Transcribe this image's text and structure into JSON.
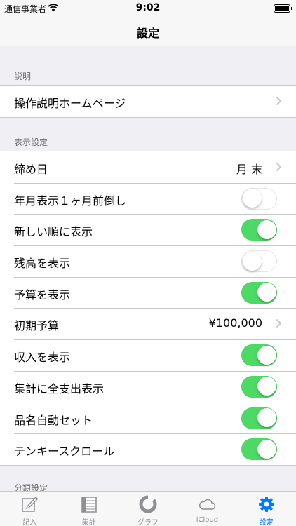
{
  "status_bar": {
    "carrier": "通信事業者",
    "time": "9:02"
  },
  "nav": {
    "title": "設定"
  },
  "sections": [
    {
      "header": "説明",
      "rows": [
        {
          "label": "操作説明ホームページ",
          "type": "link"
        }
      ]
    },
    {
      "header": "表示設定",
      "rows": [
        {
          "label": "締め日",
          "type": "value",
          "value": "月 末"
        },
        {
          "label": "年月表示１ヶ月前倒し",
          "type": "toggle",
          "on": false
        },
        {
          "label": "新しい順に表示",
          "type": "toggle",
          "on": true
        },
        {
          "label": "残高を表示",
          "type": "toggle",
          "on": false
        },
        {
          "label": "予算を表示",
          "type": "toggle",
          "on": true
        },
        {
          "label": "初期予算",
          "type": "value",
          "value": "¥100,000"
        },
        {
          "label": "収入を表示",
          "type": "toggle",
          "on": true
        },
        {
          "label": "集計に全支出表示",
          "type": "toggle",
          "on": true
        },
        {
          "label": "品名自動セット",
          "type": "toggle",
          "on": true
        },
        {
          "label": "テンキースクロール",
          "type": "toggle",
          "on": true
        }
      ]
    },
    {
      "header": "分類設定"
    }
  ],
  "tabs": [
    {
      "label": "記入",
      "icon": "pencil-note-icon",
      "active": false
    },
    {
      "label": "集計",
      "icon": "table-icon",
      "active": false
    },
    {
      "label": "グラフ",
      "icon": "pie-chart-icon",
      "active": false
    },
    {
      "label": "iCloud",
      "icon": "cloud-icon",
      "active": false
    },
    {
      "label": "設定",
      "icon": "gear-icon",
      "active": true
    }
  ],
  "colors": {
    "accent": "#007aff",
    "toggle_on": "#4cd964",
    "background": "#efeff4"
  }
}
